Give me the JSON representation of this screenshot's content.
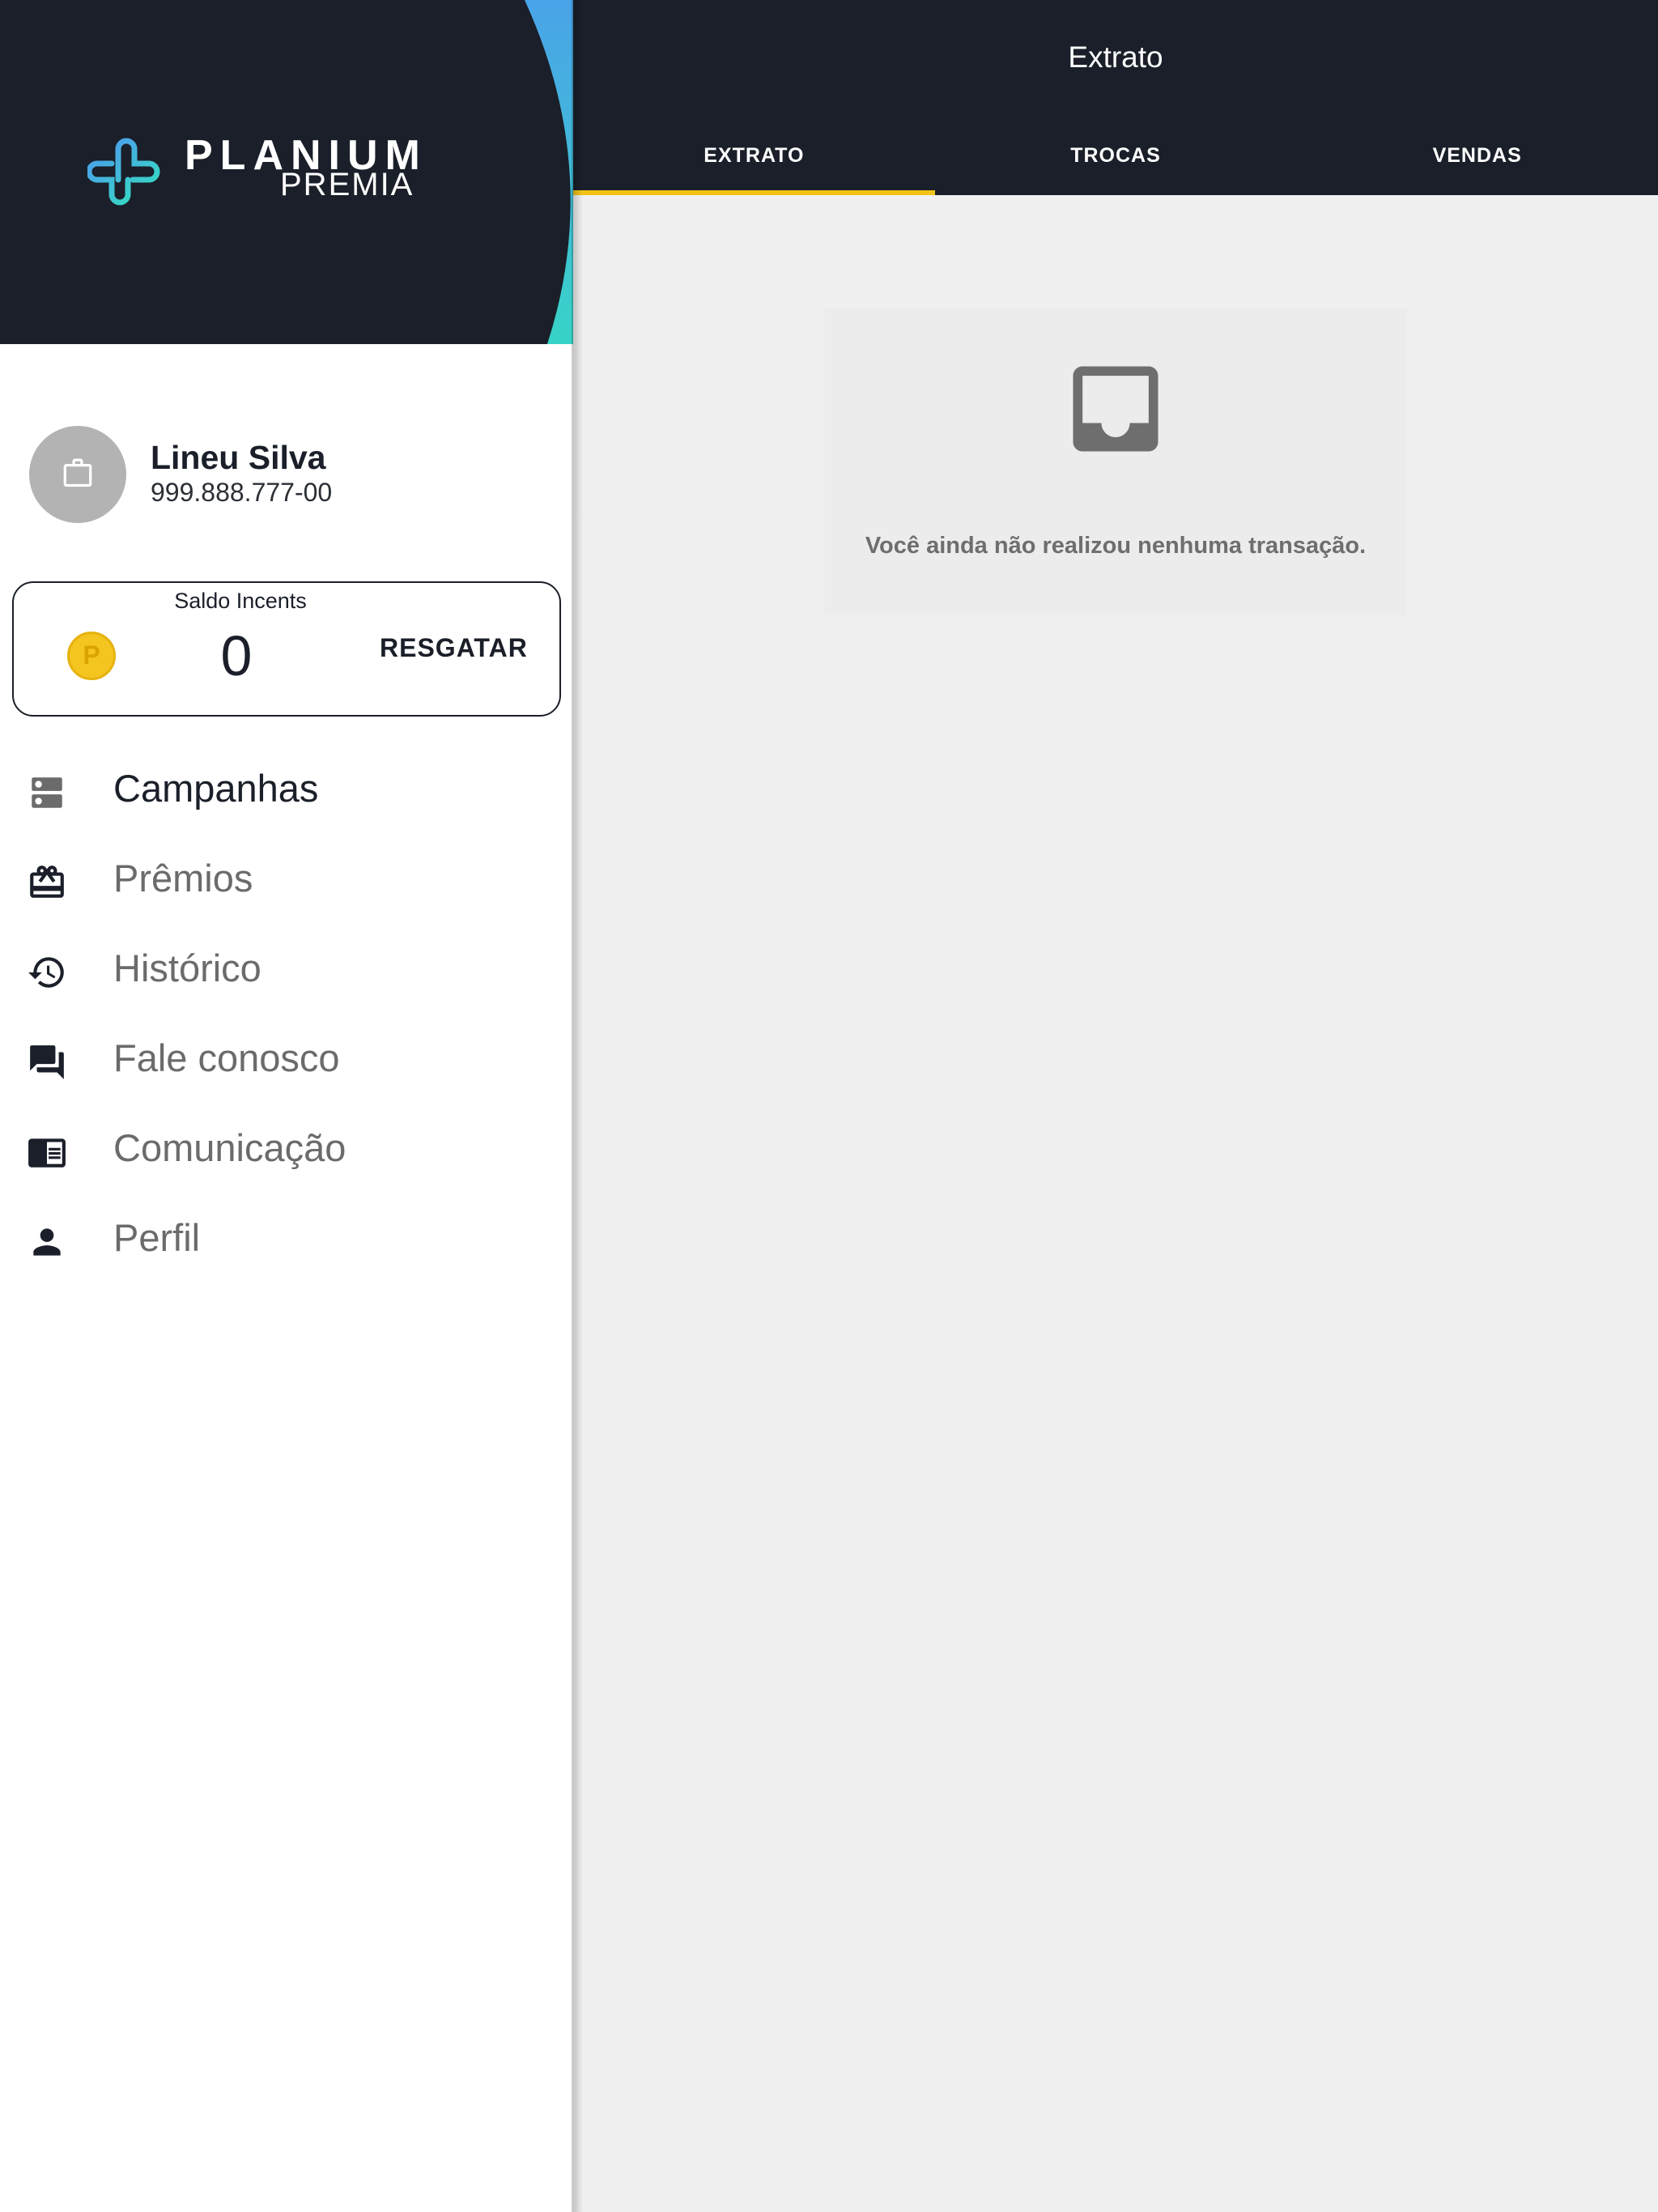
{
  "brand": {
    "name_line1": "PLANIUM",
    "name_line2": "PREMIA",
    "accent_gradient": [
      "#4aa3e8",
      "#38d3c7"
    ],
    "header_color": "#1a1f29"
  },
  "user": {
    "name": "Lineu Silva",
    "document": "999.888.777-00",
    "avatar_icon": "briefcase-icon"
  },
  "balance": {
    "label": "Saldo Incents",
    "value": "0",
    "coin_symbol": "P",
    "redeem_label": "RESGATAR"
  },
  "menu": {
    "items": [
      {
        "label": "Campanhas",
        "icon": "dns-icon"
      },
      {
        "label": "Prêmios",
        "icon": "redeem-icon"
      },
      {
        "label": "Histórico",
        "icon": "history-icon"
      },
      {
        "label": "Fale conosco",
        "icon": "forum-icon"
      },
      {
        "label": "Comunicação",
        "icon": "chrome-reader-icon"
      },
      {
        "label": "Perfil",
        "icon": "person-icon"
      }
    ]
  },
  "header": {
    "title": "Extrato"
  },
  "tabs": [
    {
      "label": "EXTRATO",
      "active": true
    },
    {
      "label": "TROCAS",
      "active": false
    },
    {
      "label": "VENDAS",
      "active": false
    }
  ],
  "tab_indicator_color": "#f2c316",
  "empty_state": {
    "icon": "inbox-icon",
    "message": "Você ainda não realizou nenhuma transação."
  }
}
